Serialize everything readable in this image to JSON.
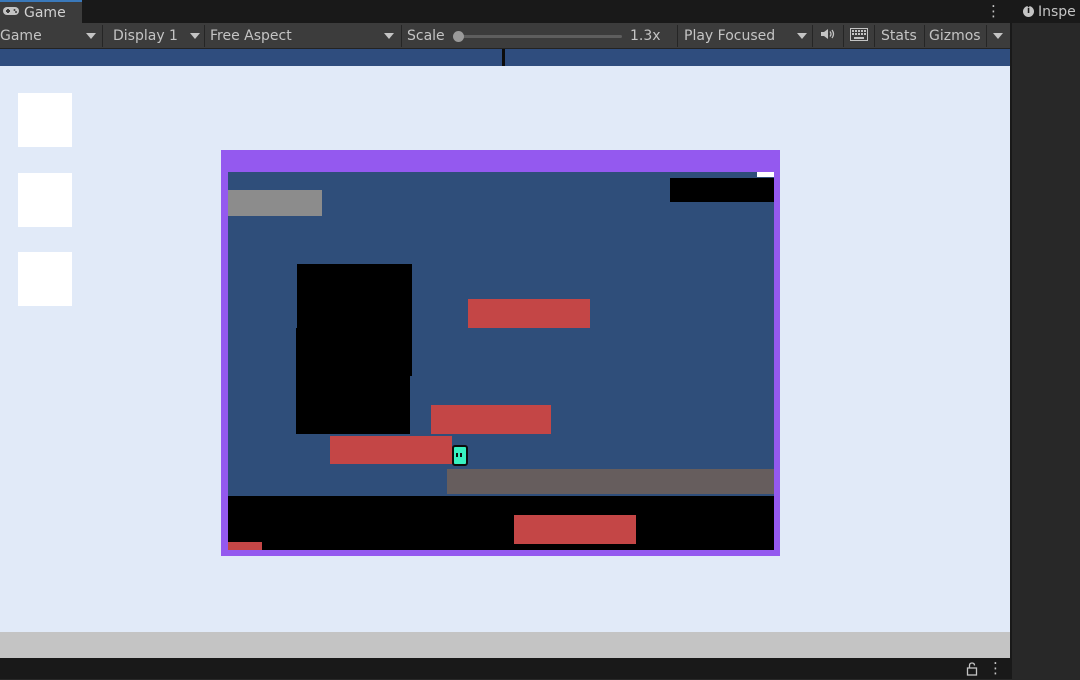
{
  "tab": {
    "label": "Game",
    "icon": "gamepad-icon"
  },
  "inspector": {
    "tab_label": "Inspe",
    "icon": "info-icon"
  },
  "toolbar": {
    "view_mode": "Game",
    "display": "Display 1",
    "aspect": "Free Aspect",
    "scale_label": "Scale",
    "scale_value": "1.3x",
    "scale_level": 0.0,
    "play_mode": "Play Focused",
    "audio_icon": "speaker-icon",
    "keyboard_icon": "keyboard-icon",
    "stats_label": "Stats",
    "gizmos_label": "Gizmos"
  },
  "colors": {
    "scene_border": "#9459ef",
    "scene_background": "#2f4e7a",
    "hazard_red": "#c44646",
    "player": "#38f1c1",
    "view_background": "#e1eaf8"
  },
  "ui_slots": [
    "empty-slot",
    "empty-slot",
    "empty-slot"
  ]
}
